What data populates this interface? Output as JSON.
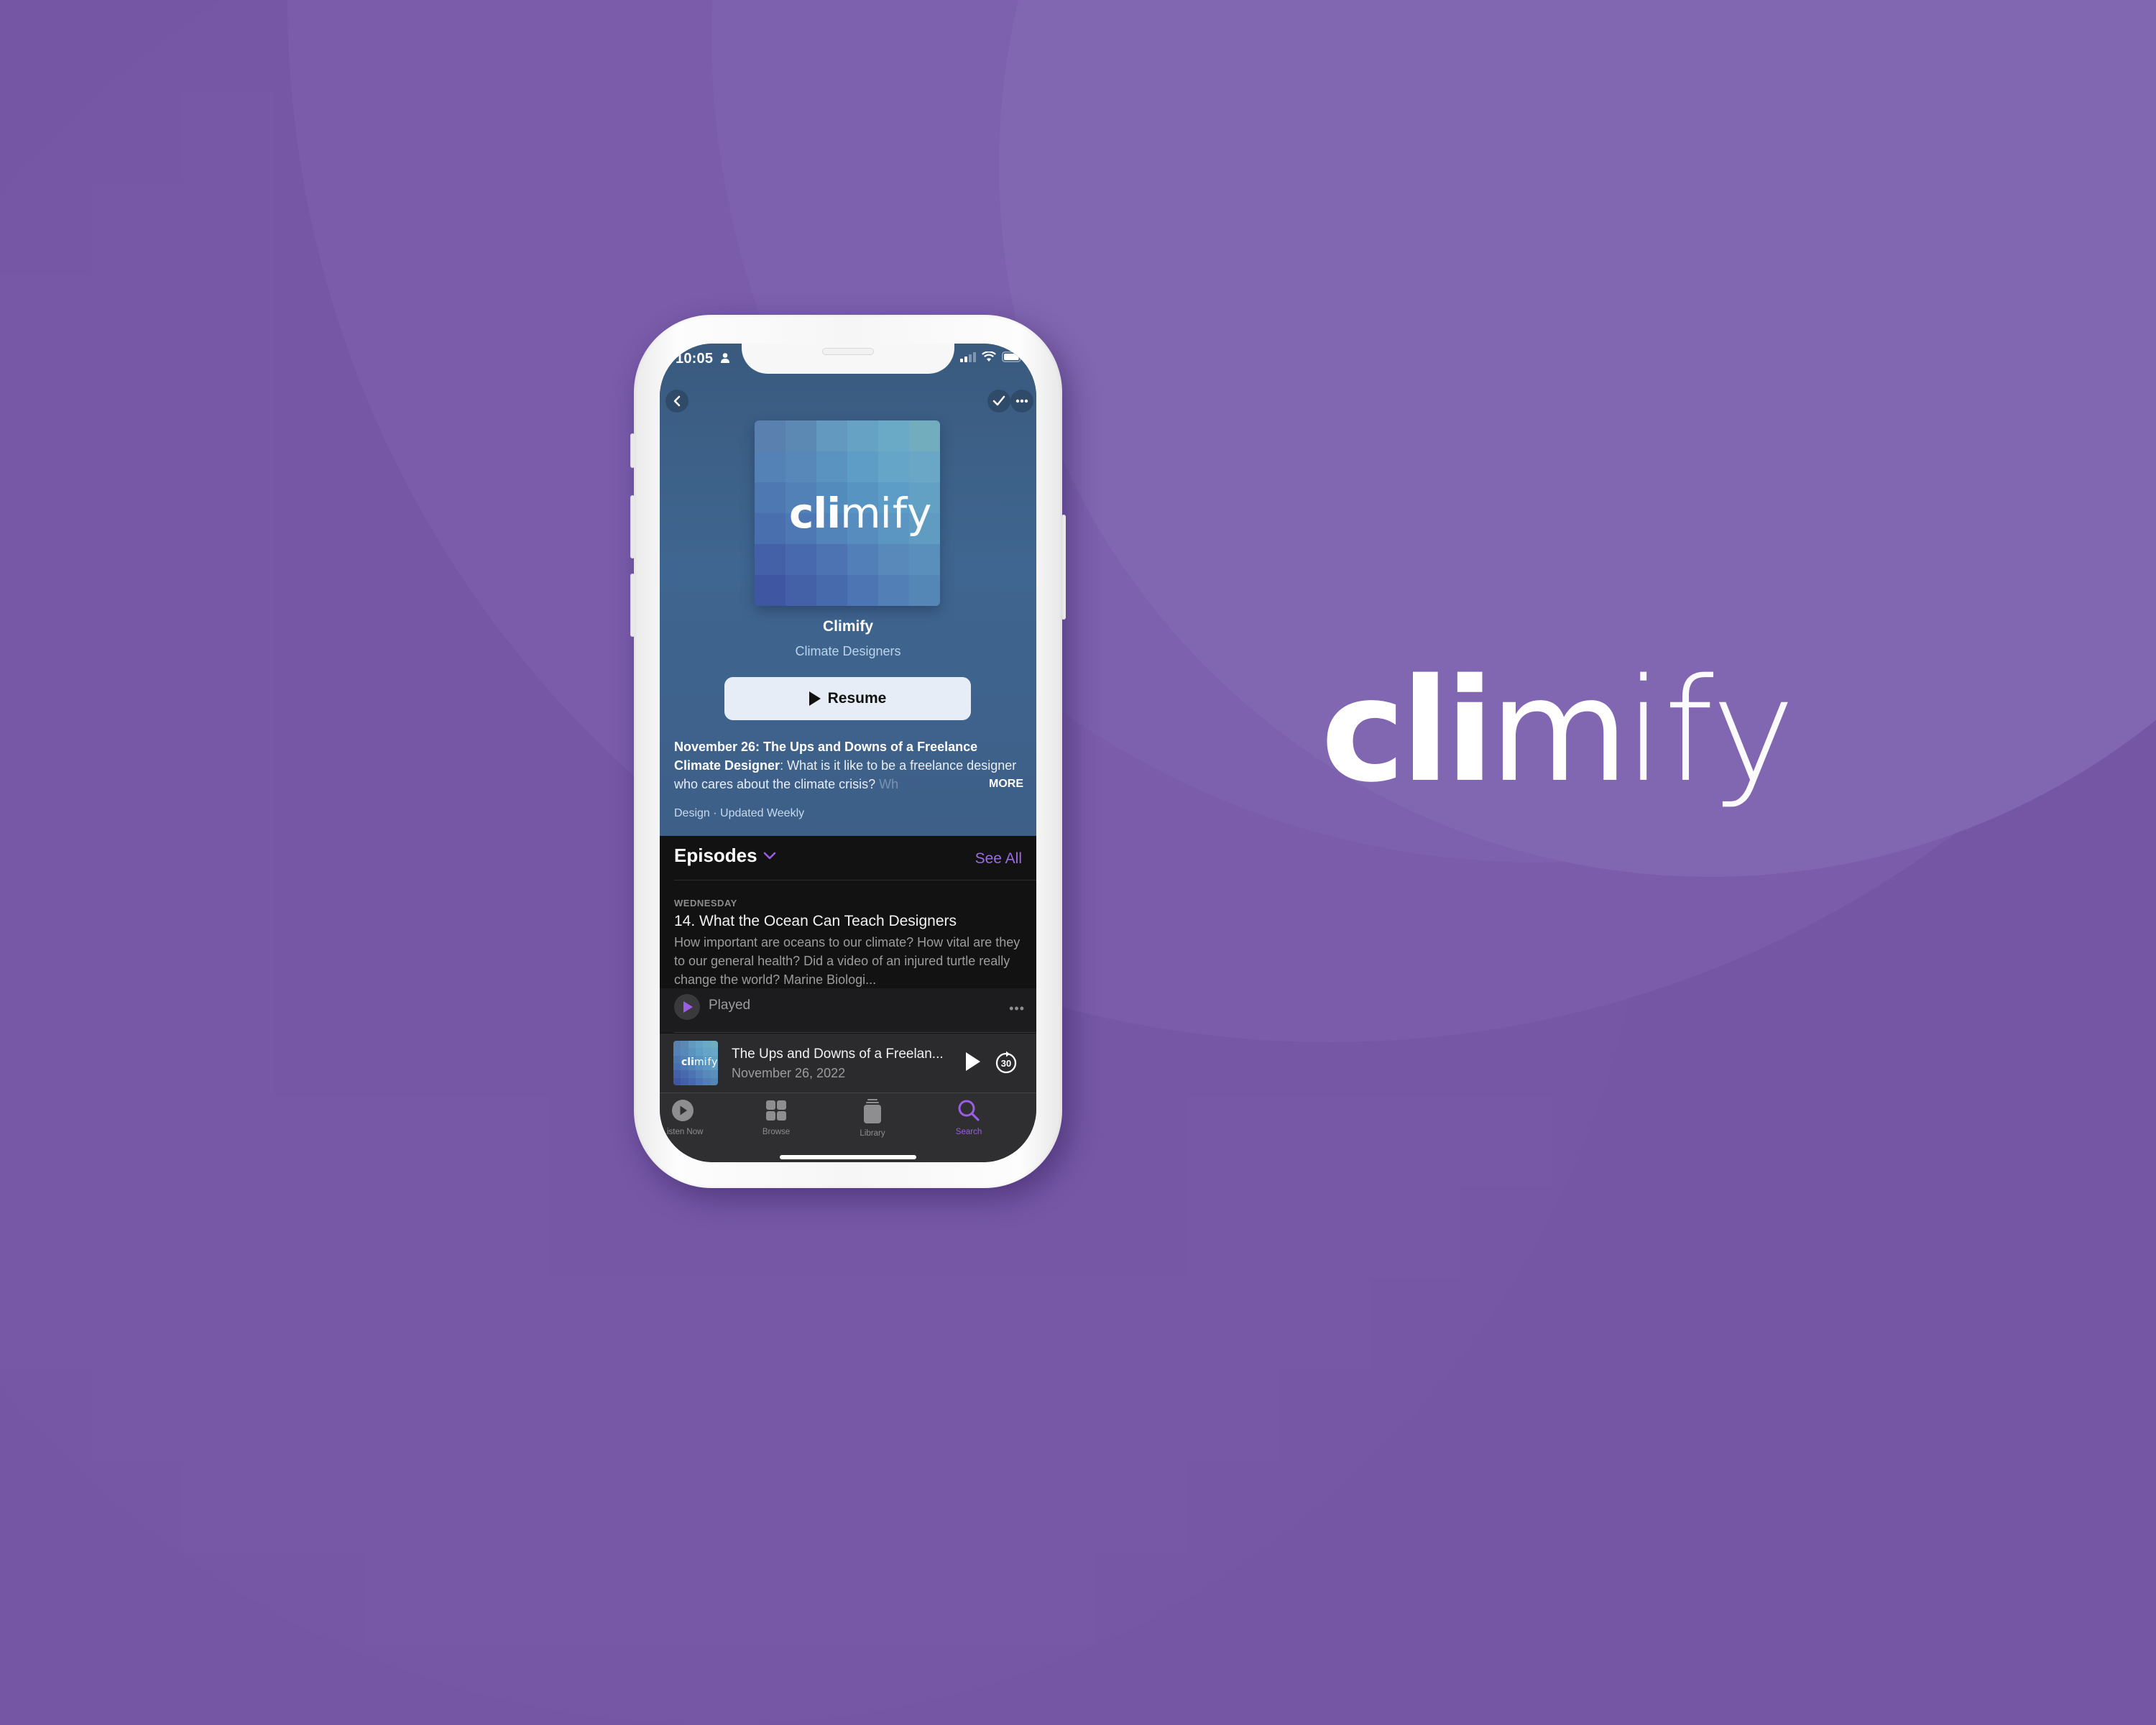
{
  "brand": {
    "name_parts": [
      "cl",
      "i",
      "m",
      "ify"
    ],
    "colors": {
      "background": "#7456a5",
      "accent": "#9b5de5",
      "hero": "#3d5f88"
    }
  },
  "status_bar": {
    "time": "10:05",
    "icons": [
      "person-icon",
      "signal-icon",
      "wifi-icon",
      "battery-icon"
    ]
  },
  "nav": {
    "back_icon": "chevron-left-icon",
    "check_icon": "checkmark-icon",
    "more_icon": "ellipsis-icon"
  },
  "podcast": {
    "artwork_logo": [
      "cl",
      "i",
      "m",
      "ify"
    ],
    "title": "Climify",
    "author": "Climate Designers",
    "resume_label": "Resume",
    "description_bold": "November 26: The Ups and Downs of a Freelance Climate Designer",
    "description_text": ": What is it like to be a freelance designer who cares about the climate crisis? ",
    "description_fade": "Wh",
    "more_label": "MORE",
    "meta": "Design · Updated Weekly"
  },
  "episodes": {
    "header": "Episodes",
    "see_all": "See All",
    "items": [
      {
        "day": "WEDNESDAY",
        "title": "14. What the Ocean Can Teach Designers",
        "description": "How important are oceans to our climate? How vital are they to our general health? Did a video of an injured turtle really change the world? Marine Biologi...",
        "status": "Played"
      }
    ]
  },
  "mini_player": {
    "artwork_logo": [
      "cl",
      "i",
      "m",
      "ify"
    ],
    "title": "The Ups and Downs of a Freelan...",
    "date": "November 26, 2022",
    "skip_label": "30"
  },
  "tabs": [
    {
      "label": "Listen Now",
      "icon": "play-circle-icon",
      "active": false
    },
    {
      "label": "Browse",
      "icon": "grid-icon",
      "active": false
    },
    {
      "label": "Library",
      "icon": "library-stack-icon",
      "active": false
    },
    {
      "label": "Search",
      "icon": "search-icon",
      "active": true
    }
  ]
}
